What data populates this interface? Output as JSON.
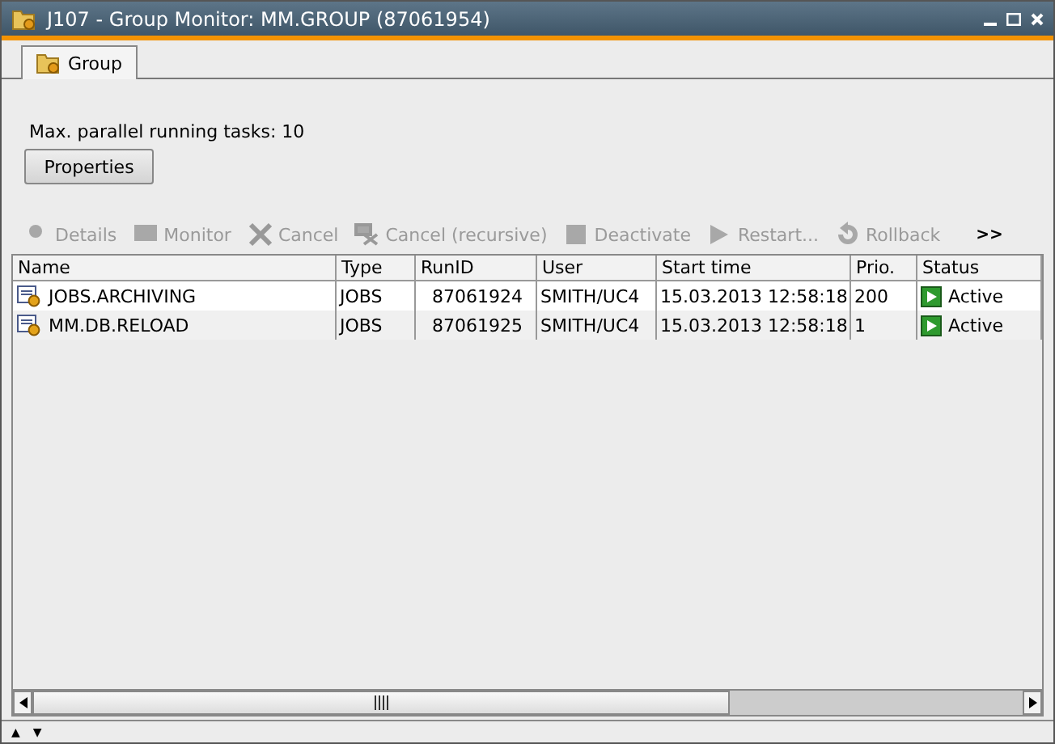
{
  "window": {
    "title": "J107 - Group Monitor: MM.GROUP (87061954)"
  },
  "tabs": [
    {
      "label": "Group",
      "selected": true
    }
  ],
  "info": "Max. parallel running tasks: 10",
  "properties_button": "Properties",
  "toolbar": [
    {
      "label": "Details",
      "kind": "details",
      "disabled": true
    },
    {
      "label": "Monitor",
      "kind": "monitor",
      "disabled": true
    },
    {
      "label": "Cancel",
      "kind": "cancel",
      "disabled": true
    },
    {
      "label": "Cancel (recursive)",
      "kind": "cancel_recursive",
      "disabled": true
    },
    {
      "label": "Deactivate",
      "kind": "deactivate",
      "disabled": true
    },
    {
      "label": "Restart...",
      "kind": "restart",
      "disabled": true
    },
    {
      "label": "Rollback",
      "kind": "rollback",
      "disabled": true
    }
  ],
  "toolbar_more": ">>",
  "table": {
    "columns": [
      "Name",
      "Type",
      "RunID",
      "User",
      "Start time",
      "Prio.",
      "Status"
    ],
    "rows": [
      {
        "cells": [
          "JOBS.ARCHIVING",
          "JOBS",
          "87061924",
          "SMITH/UC4",
          "15.03.2013 12:58:18",
          "200",
          "Active"
        ],
        "selected": false
      },
      {
        "cells": [
          "MM.DB.RELOAD",
          "JOBS",
          "87061925",
          "SMITH/UC4",
          "15.03.2013 12:58:18",
          "1",
          "Active"
        ],
        "selected": false
      }
    ]
  },
  "footer": {
    "up": "▲",
    "down": "▼"
  }
}
